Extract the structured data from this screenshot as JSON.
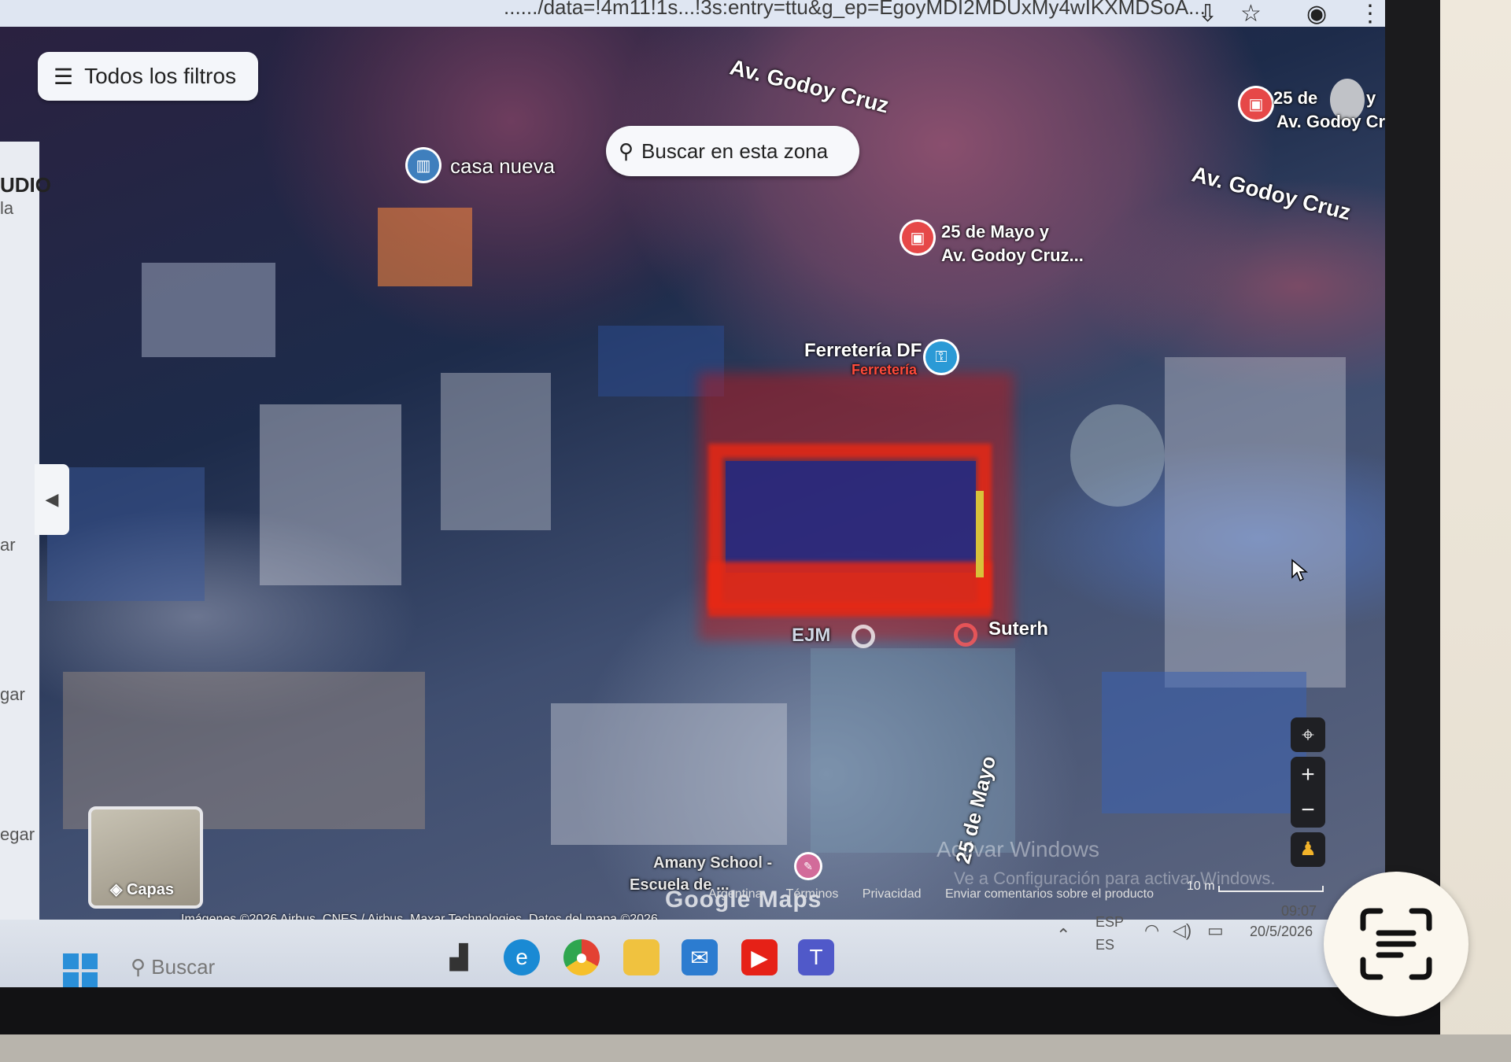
{
  "browser": {
    "url_fragment": "....../data=!4m11!1s...!3s:entry=ttu&g_ep=EgoyMDI2MDUxMy4wIKXMDSoA..."
  },
  "map": {
    "filters_button": "Todos los filtros",
    "search_area_button": "Buscar en esta zona",
    "streets": {
      "godoy_cruz_top": "Av. Godoy Cruz",
      "godoy_cruz_right": "Av. Godoy Cruz",
      "veinticinco_de_mayo": "25 de Mayo"
    },
    "pois": {
      "casa_nueva": "casa nueva",
      "bus_stop_1_line1": "25 de Mayo y",
      "bus_stop_1_line2": "Av. Godoy Cruz...",
      "bus_stop_2_line1": "25 de",
      "bus_stop_2_suffix": "y",
      "bus_stop_2_line2": "Av. Godoy Cruz",
      "ferreteria_name": "Ferretería DF",
      "ferreteria_category": "Ferretería",
      "ejm": "EJM",
      "suterh": "Suterh",
      "school_line1": "Amany School -",
      "school_line2": "Escuela de ..."
    },
    "sidebar_partial": [
      "UDIO",
      "la",
      "ar",
      "gar",
      "egar"
    ],
    "layers_button": "Capas",
    "watermark": "Google Maps",
    "attribution": "Imágenes ©2026 Airbus, CNES / Airbus, Maxar Technologies, Datos del mapa ©2026",
    "footer_links": [
      "Argentina",
      "Términos",
      "Privacidad",
      "Enviar comentarios sobre el producto"
    ],
    "scale_label": "10 m",
    "activate_windows_line1": "Activar Windows",
    "activate_windows_line2": "Ve a Configuración para activar Windows."
  },
  "taskbar": {
    "search_placeholder": "Buscar",
    "language_line1": "ESP",
    "language_line2": "ES",
    "time": "09:07",
    "date": "20/5/2026"
  },
  "colors": {
    "transit_pin": "#e64848",
    "ferreteria_pin": "#2b9ad6",
    "ferreteria_category": "#ff4a3a",
    "highlight_red": "#e62814"
  }
}
